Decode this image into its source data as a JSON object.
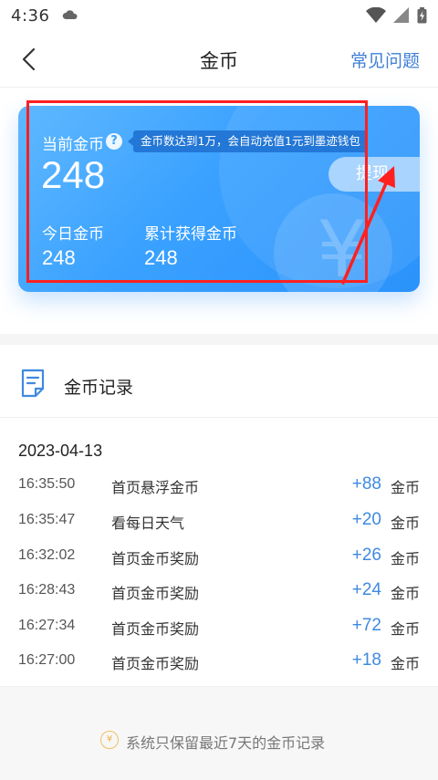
{
  "status_bar": {
    "time": "4:36"
  },
  "header": {
    "title": "金币",
    "faq": "常见问题"
  },
  "card": {
    "current_label": "当前金币",
    "help_symbol": "?",
    "tooltip": "金币数达到1万，会自动充值1元到墨迹钱包",
    "current_value": "248",
    "withdraw_label": "提现",
    "today_label": "今日金币",
    "today_value": "248",
    "total_label": "累计获得金币",
    "total_value": "248",
    "colors": {
      "gradient_start": "#5fb8ff",
      "gradient_end": "#2a93fb"
    }
  },
  "records": {
    "title": "金币记录",
    "date": "2023-04-13",
    "unit": "金币",
    "items": [
      {
        "time": "16:35:50",
        "desc": "首页悬浮金币",
        "amount": "+88"
      },
      {
        "time": "16:35:47",
        "desc": "看每日天气",
        "amount": "+20"
      },
      {
        "time": "16:32:02",
        "desc": "首页金币奖励",
        "amount": "+26"
      },
      {
        "time": "16:28:43",
        "desc": "首页金币奖励",
        "amount": "+24"
      },
      {
        "time": "16:27:34",
        "desc": "首页金币奖励",
        "amount": "+72"
      },
      {
        "time": "16:27:00",
        "desc": "首页金币奖励",
        "amount": "+18"
      }
    ]
  },
  "footer": {
    "icon_symbol": "¥",
    "text": "系统只保留最近7天的金币记录"
  },
  "icons": [
    "cloud-icon",
    "wifi-icon",
    "signal-icon",
    "battery-icon",
    "back-arrow-icon",
    "help-icon",
    "records-doc-icon",
    "coin-icon"
  ]
}
